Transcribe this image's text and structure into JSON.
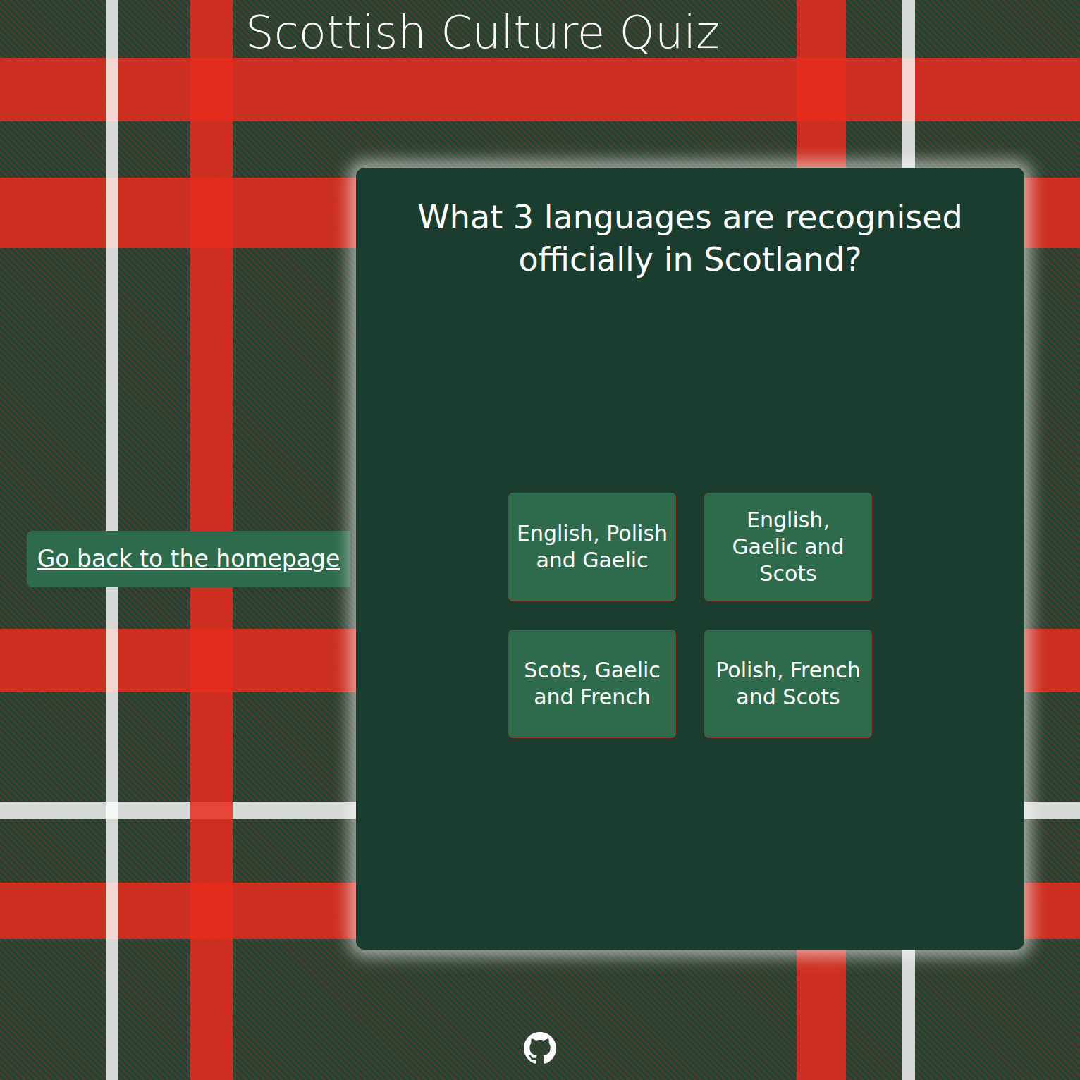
{
  "header": {
    "title": "Scottish Culture Quiz"
  },
  "nav": {
    "back_link": "Go back to the homepage"
  },
  "quiz": {
    "question": "What 3 languages are recognised officially in Scotland?",
    "answers": [
      "English, Polish and Gaelic",
      "English, Gaelic and Scots",
      "Scots, Gaelic and French",
      "Polish, French and Scots"
    ]
  }
}
